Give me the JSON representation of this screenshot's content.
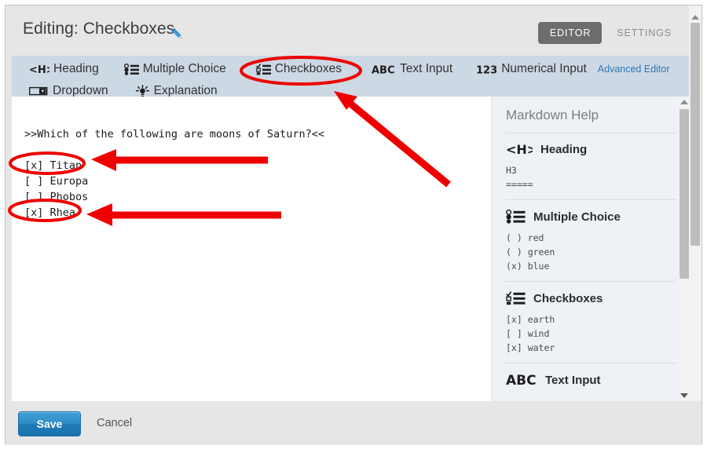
{
  "header": {
    "title": "Editing: Checkboxes",
    "edit_icon": "pencil-icon",
    "editor_tab": "EDITOR",
    "settings_tab": "SETTINGS"
  },
  "toolbar": {
    "row1": [
      {
        "icon": "heading-icon",
        "label": "Heading"
      },
      {
        "icon": "multiple-choice-icon",
        "label": "Multiple Choice"
      },
      {
        "icon": "checkboxes-icon",
        "label": "Checkboxes"
      },
      {
        "icon": "abc-text-input-icon",
        "label": "Text Input"
      },
      {
        "icon": "numeric-123-icon",
        "label": "Numerical Input"
      }
    ],
    "row2": [
      {
        "icon": "dropdown-icon",
        "label": "Dropdown"
      },
      {
        "icon": "explanation-icon",
        "label": "Explanation"
      }
    ],
    "advanced_editor_link": "Advanced Editor"
  },
  "editor": {
    "prompt_line": ">>Which of the following are moons of Saturn?<<",
    "blank_line": "",
    "options": [
      "[x] Titan",
      "[ ] Europa",
      "[ ] Phobos",
      "[x] Rhea"
    ]
  },
  "help": {
    "title": "Markdown Help",
    "sections": [
      {
        "icon": "heading-icon",
        "heading": "Heading",
        "code": "H3\n====="
      },
      {
        "icon": "multiple-choice-icon",
        "heading": "Multiple Choice",
        "code": "( ) red\n( ) green\n(x) blue"
      },
      {
        "icon": "checkboxes-icon",
        "heading": "Checkboxes",
        "code": "[x] earth\n[ ] wind\n[x] water"
      },
      {
        "icon": "abc-text-input-icon",
        "heading": "Text Input",
        "code": ""
      }
    ]
  },
  "footer": {
    "save_label": "Save",
    "cancel_label": "Cancel"
  },
  "annotations": {
    "color": "#ee0000",
    "shapes": [
      "ellipse-around-checkboxes-toolbar-button",
      "arrow-pointing-to-checkboxes-toolbar-button",
      "ellipse-around-titan-option",
      "arrow-pointing-to-titan-option",
      "ellipse-around-rhea-option",
      "arrow-pointing-to-rhea-option"
    ]
  },
  "colors": {
    "toolbar_bg": "#ccd8e3",
    "chrome_bg": "#e6e6e6",
    "help_bg": "#eef1f5",
    "accent_link": "#2c77b5",
    "save_button": "#1f7cb8",
    "active_tab": "#6d6d6d",
    "annotation_red": "#ee0000"
  }
}
